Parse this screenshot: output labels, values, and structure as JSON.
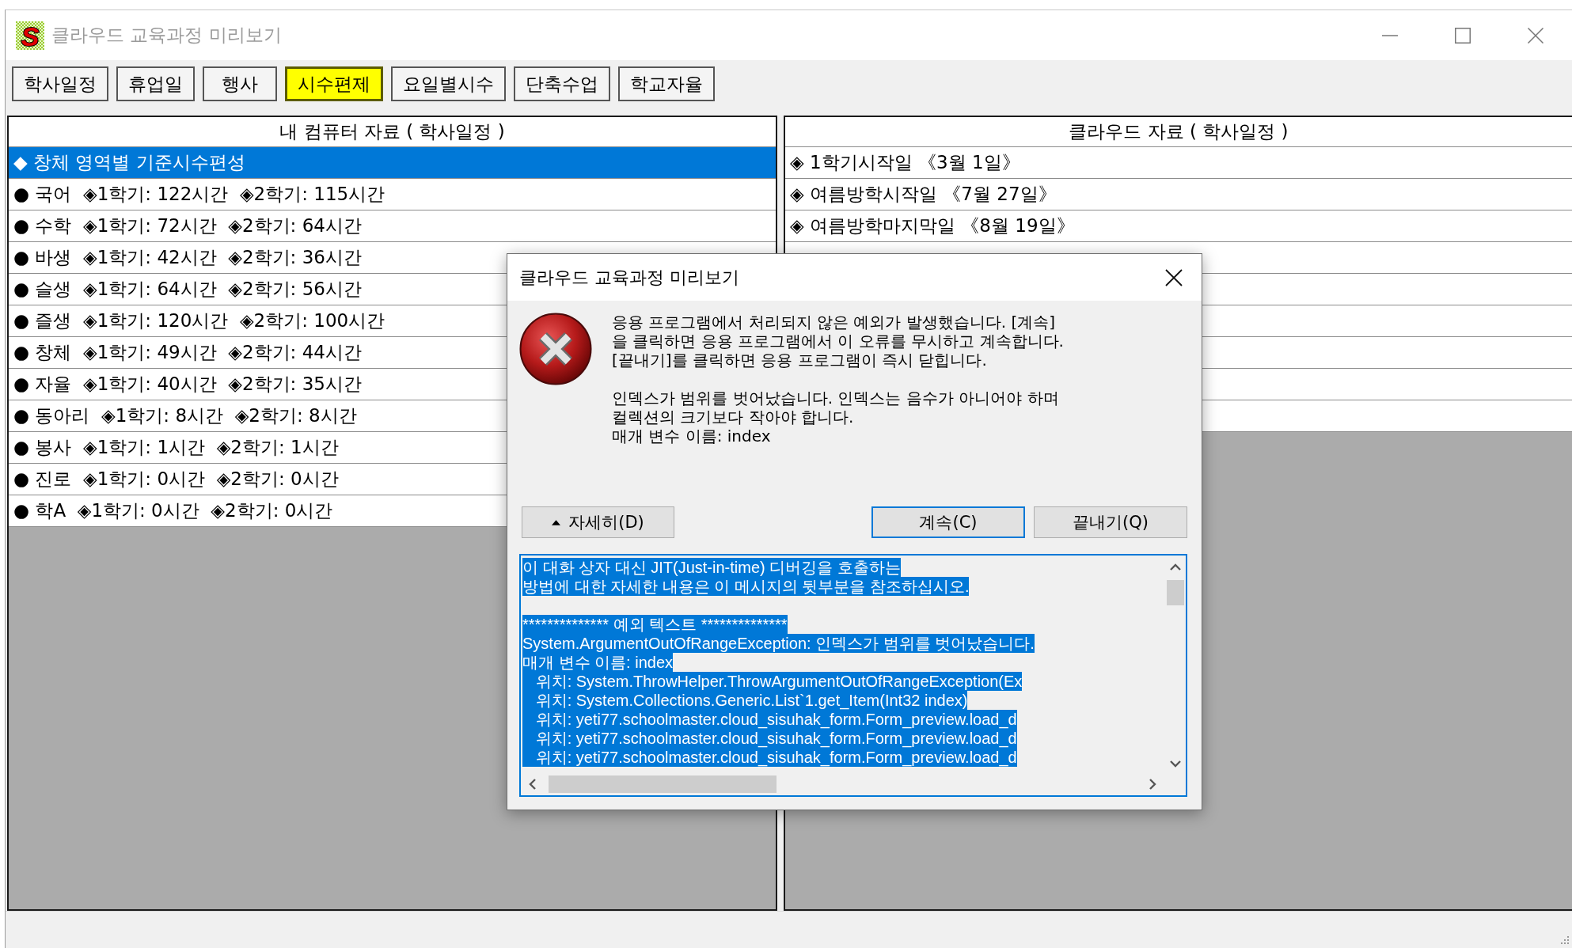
{
  "window": {
    "title": "클라우드 교육과정 미리보기",
    "active": false,
    "logo": "S"
  },
  "tabs": [
    {
      "label": "학사일정",
      "selected": false
    },
    {
      "label": "휴업일",
      "selected": false
    },
    {
      "label": "행사",
      "selected": false
    },
    {
      "label": "시수편제",
      "selected": true
    },
    {
      "label": "요일별시수",
      "selected": false
    },
    {
      "label": "단축수업",
      "selected": false
    },
    {
      "label": "학교자율",
      "selected": false
    }
  ],
  "local_panel": {
    "title": "내 컴퓨터 자료 ( 학사일정 )",
    "rows": [
      {
        "marker": "◆",
        "text": "창체 영역별 기준시수편성",
        "selected": true
      },
      {
        "marker": "●",
        "text": "국어  ◈1학기: 122시간  ◈2학기: 115시간",
        "selected": false
      },
      {
        "marker": "●",
        "text": "수학  ◈1학기: 72시간  ◈2학기: 64시간",
        "selected": false
      },
      {
        "marker": "●",
        "text": "바생  ◈1학기: 42시간  ◈2학기: 36시간",
        "selected": false
      },
      {
        "marker": "●",
        "text": "슬생  ◈1학기: 64시간  ◈2학기: 56시간",
        "selected": false
      },
      {
        "marker": "●",
        "text": "즐생  ◈1학기: 120시간  ◈2학기: 100시간",
        "selected": false
      },
      {
        "marker": "●",
        "text": "창체  ◈1학기: 49시간  ◈2학기: 44시간",
        "selected": false
      },
      {
        "marker": "●",
        "text": "자율  ◈1학기: 40시간  ◈2학기: 35시간",
        "selected": false
      },
      {
        "marker": "●",
        "text": "동아리  ◈1학기: 8시간  ◈2학기: 8시간",
        "selected": false
      },
      {
        "marker": "●",
        "text": "봉사  ◈1학기: 1시간  ◈2학기: 1시간",
        "selected": false
      },
      {
        "marker": "●",
        "text": "진로  ◈1학기: 0시간  ◈2학기: 0시간",
        "selected": false
      },
      {
        "marker": "●",
        "text": "학A  ◈1학기: 0시간  ◈2학기: 0시간",
        "selected": false
      }
    ]
  },
  "cloud_panel": {
    "title": "클라우드 자료 ( 학사일정 )",
    "rows": [
      {
        "marker": "◈",
        "text": "1학기시작일 《3월 1일》",
        "selected": false
      },
      {
        "marker": "◈",
        "text": "여름방학시작일 《7월 27일》",
        "selected": false
      },
      {
        "marker": "◈",
        "text": "여름방학마지막일 《8월 19일》",
        "selected": false
      }
    ]
  },
  "dialog": {
    "title": "클라우드 교육과정 미리보기",
    "message": [
      [
        "응용 프로그램에서 처리되지 않은 예외가 발생했습니다. [계속]",
        "을 클릭하면 응용 프로그램에서 이 오류를 무시하고 계속합니다.",
        "[끝내기]를 클릭하면 응용 프로그램이 즉시 닫힙니다."
      ],
      [
        "인덱스가 범위를 벗어났습니다. 인덱스는 음수가 아니어야 하며",
        "컬렉션의 크기보다 작아야 합니다.",
        "매개 변수 이름: index"
      ]
    ],
    "details_button": {
      "label": "자세히(D)",
      "expanded": true
    },
    "buttons": [
      {
        "label": "계속(C)",
        "focused": true
      },
      {
        "label": "끝내기(Q)",
        "focused": false
      }
    ],
    "details": {
      "selected": true,
      "blocks": [
        [
          "이 대화 상자 대신 JIT(Just-in-time) 디버깅을 호출하는",
          "방법에 대한 자세한 내용은 이 메시지의 뒷부분을 참조하십시오."
        ],
        [
          "************** 예외 텍스트 **************",
          "System.ArgumentOutOfRangeException: 인덱스가 범위를 벗어났습니다.",
          "매개 변수 이름: index",
          "   위치: System.ThrowHelper.ThrowArgumentOutOfRangeException(Ex",
          "   위치: System.Collections.Generic.List`1.get_Item(Int32 index)",
          "   위치: yeti77.schoolmaster.cloud_sisuhak_form.Form_preview.load_d",
          "   위치: yeti77.schoolmaster.cloud_sisuhak_form.Form_preview.load_d",
          "   위치: yeti77.schoolmaster.cloud_sisuhak_form.Form_preview.load_d"
        ]
      ]
    }
  }
}
